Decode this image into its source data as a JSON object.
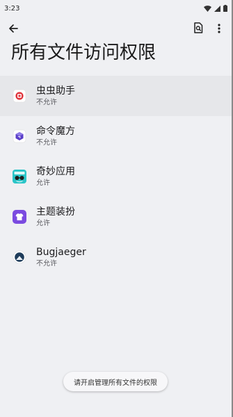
{
  "status_bar": {
    "time": "3:23"
  },
  "top_bar": {
    "back_icon": "arrow-left-icon",
    "search_icon": "document-search-icon",
    "more_icon": "more-vertical-icon"
  },
  "page": {
    "title": "所有文件访问权限"
  },
  "apps": [
    {
      "name": "虫虫助手",
      "status": "不允许",
      "icon": "chongchong-app-icon",
      "selected": true
    },
    {
      "name": "命令魔方",
      "status": "不允许",
      "icon": "command-cube-app-icon",
      "selected": false
    },
    {
      "name": "奇妙应用",
      "status": "允许",
      "icon": "qimiao-app-icon",
      "selected": false
    },
    {
      "name": "主题装扮",
      "status": "允许",
      "icon": "theme-app-icon",
      "selected": false
    },
    {
      "name": "Bugjaeger",
      "status": "不允许",
      "icon": "bugjaeger-app-icon",
      "selected": false
    }
  ],
  "toast": {
    "message": "请开启管理所有文件的权限"
  },
  "colors": {
    "background": "#eff0f3",
    "selected_row": "#e6e7ea",
    "theme_purple": "#7b4be0",
    "qimiao_teal": "#2bc5c8",
    "chongchong_red": "#e0353d"
  }
}
